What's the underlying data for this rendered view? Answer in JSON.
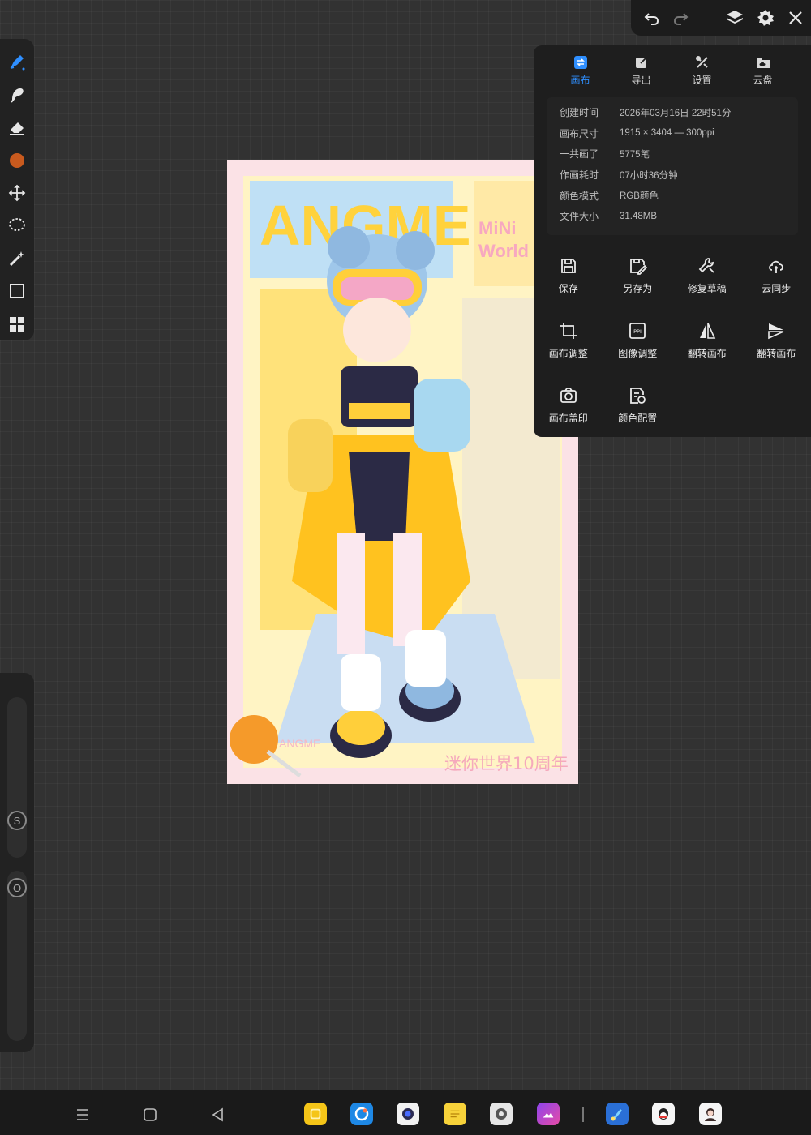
{
  "topbar": {
    "icons": [
      "undo-icon",
      "redo-icon",
      "layers-icon",
      "gear-icon",
      "close-icon"
    ]
  },
  "left_toolbar": {
    "tools": [
      "pen-brush-icon",
      "smudge-icon",
      "eraser-icon",
      "color-swatch",
      "move-transform-icon",
      "lasso-select-icon",
      "magic-wand-icon",
      "rectangle-icon",
      "gallery-grid-icon"
    ],
    "active_color": "#c85a1e",
    "accent": "#2f8fff"
  },
  "left_rail": {
    "size_slider_label": "S",
    "opacity_slider_label": "O"
  },
  "panel": {
    "tabs": [
      {
        "label": "画布",
        "icon": "canvas-icon",
        "active": true
      },
      {
        "label": "导出",
        "icon": "export-icon",
        "active": false
      },
      {
        "label": "设置",
        "icon": "tools-icon",
        "active": false
      },
      {
        "label": "云盘",
        "icon": "cloud-drive-icon",
        "active": false
      }
    ],
    "info": [
      {
        "label": "创建时间",
        "value": "2026年03月16日  22时51分"
      },
      {
        "label": "画布尺寸",
        "value": "1915 × 3404  —  300ppi"
      },
      {
        "label": "一共画了",
        "value": "5775笔"
      },
      {
        "label": "作画耗时",
        "value": "07小时36分钟"
      },
      {
        "label": "颜色模式",
        "value": "RGB颜色"
      },
      {
        "label": "文件大小",
        "value": "31.48MB"
      }
    ],
    "actions": [
      {
        "label": "保存",
        "icon": "save-icon"
      },
      {
        "label": "另存为",
        "icon": "save-as-icon"
      },
      {
        "label": "修复草稿",
        "icon": "repair-icon"
      },
      {
        "label": "云同步",
        "icon": "cloud-sync-icon"
      },
      {
        "label": "画布调整",
        "icon": "crop-icon"
      },
      {
        "label": "图像调整",
        "icon": "ppi-icon"
      },
      {
        "label": "翻转画布",
        "icon": "flip-horizontal-icon"
      },
      {
        "label": "翻转画布",
        "icon": "flip-vertical-icon"
      },
      {
        "label": "画布盖印",
        "icon": "camera-stamp-icon"
      },
      {
        "label": "颜色配置",
        "icon": "color-profile-icon"
      }
    ]
  },
  "artwork": {
    "texts": [
      "ANGME",
      "MiNi",
      "World",
      "迷你世界10周年",
      "ANGME"
    ]
  },
  "bottom_nav": {
    "buttons": [
      "menu-icon",
      "home-icon",
      "back-icon"
    ],
    "apps": [
      {
        "name": "notes-yellow-app",
        "color": "#f5c518"
      },
      {
        "name": "browser-app",
        "color": "#1e88e5"
      },
      {
        "name": "camera-app",
        "color": "#f2f2f2"
      },
      {
        "name": "memo-app",
        "color": "#f7d23a"
      },
      {
        "name": "settings-app",
        "color": "#e6e6e6"
      },
      {
        "name": "gallery-app",
        "color": "#8e44ec"
      },
      {
        "name": "painting-app",
        "color": "#2a6fd6"
      },
      {
        "name": "qq-app",
        "color": "#f5f5f5"
      },
      {
        "name": "avatar-app",
        "color": "#f5f5f5"
      }
    ]
  }
}
